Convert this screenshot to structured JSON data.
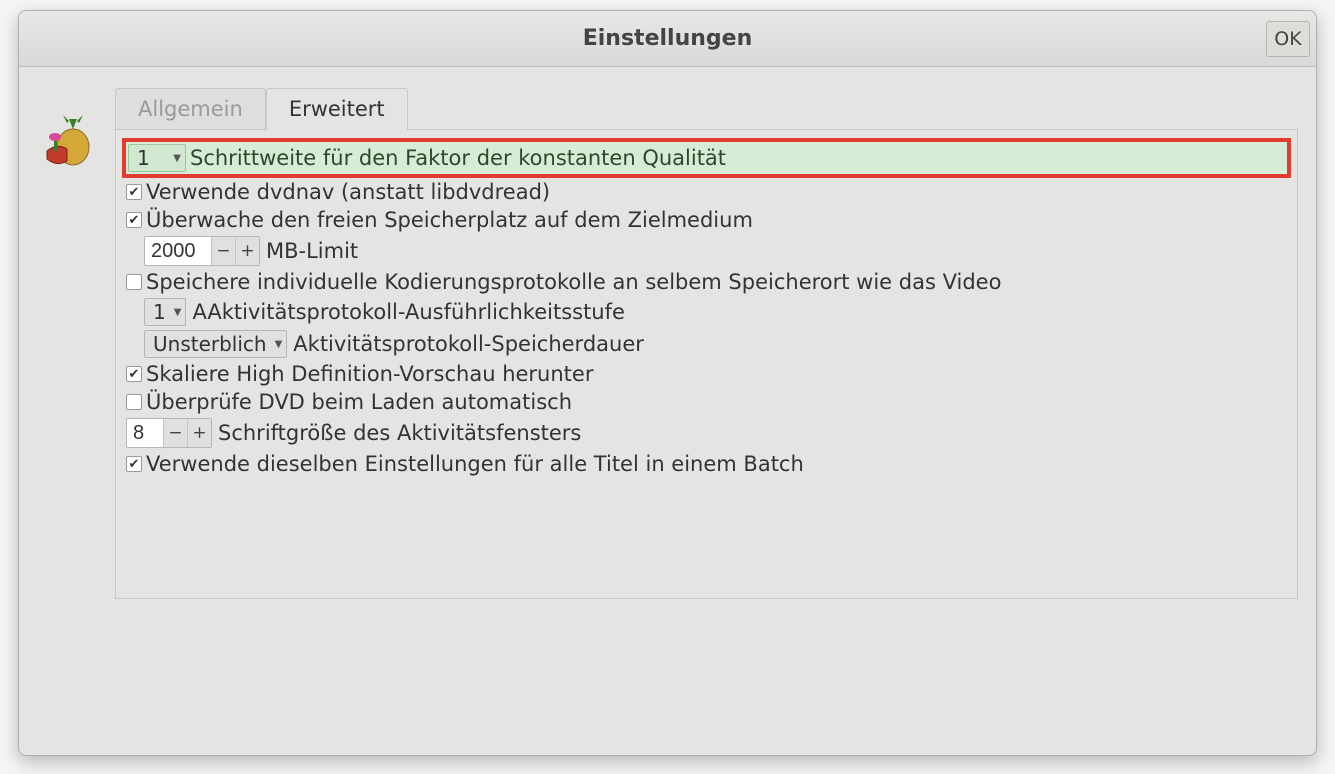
{
  "window": {
    "title": "Einstellungen",
    "ok_label": "OK"
  },
  "tabs": {
    "general": "Allgemein",
    "advanced": "Erweitert"
  },
  "settings": {
    "quality_step": {
      "value": "1",
      "label": "Schrittweite für den Faktor der konstanten Qualität"
    },
    "use_dvdnav": {
      "checked": true,
      "label": "Verwende dvdnav (anstatt libdvdread)"
    },
    "monitor_space": {
      "checked": true,
      "label": "Überwache den freien Speicherplatz auf dem Zielmedium"
    },
    "mb_limit": {
      "value": "2000",
      "label": "MB-Limit"
    },
    "store_logs": {
      "checked": false,
      "label": "Speichere individuelle Kodierungsprotokolle an selbem Speicherort wie das Video"
    },
    "log_verbosity": {
      "value": "1",
      "label": "AAktivitätsprotokoll-Ausführlichkeitsstufe"
    },
    "log_retention": {
      "value": "Unsterblich",
      "label": "Aktivitätsprotokoll-Speicherdauer"
    },
    "scale_hd": {
      "checked": true,
      "label": "Skaliere High Definition-Vorschau herunter"
    },
    "check_dvd": {
      "checked": false,
      "label": "Überprüfe DVD beim Laden automatisch"
    },
    "font_size": {
      "value": "8",
      "label": "Schriftgröße des Aktivitätsfensters"
    },
    "same_settings": {
      "checked": true,
      "label": "Verwende dieselben Einstellungen für alle Titel in einem Batch"
    }
  }
}
